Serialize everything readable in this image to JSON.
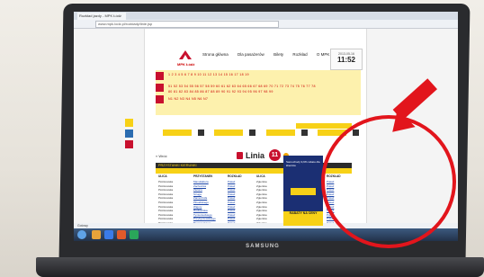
{
  "browser": {
    "tab_title": "Rozkład jazdy - MPK Łódź",
    "url": "www.mpk.lodz.pl/rozklady/linie.jsp"
  },
  "site": {
    "logo_text": "MPK Łódź",
    "nav": [
      "Strona główna",
      "Dla pasażerów",
      "Bilety",
      "Rozkład",
      "O MPK",
      "Kontakt"
    ],
    "clock": {
      "date": "2013-05-16",
      "time": "11:52"
    }
  },
  "lines": {
    "row1": "1 2 3 4 5 6 7 8 9 10 11 12 13 14 15 16 17 18 19",
    "row2": "51 52 53 54 55 56 57 58 59 60 61 62 63 64 65 66 67 68 69 70 71 72 73 74 75 76 77 78",
    "row3": "80 81 82 83 84 85 86 87 88 89 90 91 92 93 94 95 96 97 98 99",
    "row4": "N1 N2 N3 N4 N5 N6 N7"
  },
  "page": {
    "back_label": "« Wróć",
    "line_title": "Linia",
    "line_number": "11"
  },
  "table": {
    "header": "PRZYSTANKI KIERUNKI",
    "columns": [
      "ULICA",
      "PRZYSTANEK",
      "ROZKŁAD",
      "ULICA",
      "PRZYSTANEK",
      "ROZKŁAD"
    ],
    "rows": [
      [
        "Piotrkowska",
        "Manufaktura",
        "Pokaż",
        "Zgierska",
        "Stoki",
        "Pokaż"
      ],
      [
        "Piotrkowska",
        "Zachodnia",
        "Pokaż",
        "Zgierska",
        "Julianów",
        "Pokaż"
      ],
      [
        "Piotrkowska",
        "Zielona",
        "Pokaż",
        "Zgierska",
        "Radogoszcz",
        "Pokaż"
      ],
      [
        "Piotrkowska",
        "Struga",
        "Pokaż",
        "Zgierska",
        "Teofilów",
        "Pokaż"
      ],
      [
        "Piotrkowska",
        "Zamenhofa",
        "Pokaż",
        "Zgierska",
        "Bałuty",
        "Pokaż"
      ],
      [
        "Piotrkowska",
        "Piłsudskiego",
        "Pokaż",
        "Zgierska",
        "Doły",
        "Pokaż"
      ],
      [
        "Piotrkowska",
        "Wigury",
        "Pokaż",
        "Zgierska",
        "Marysin",
        "Pokaż"
      ],
      [
        "Piotrkowska",
        "Radwańska",
        "Pokaż",
        "Zgierska",
        "Helenówek",
        "Pokaż"
      ],
      [
        "Piotrkowska",
        "Tymienieckiego",
        "Pokaż",
        "Zgierska",
        "Rojna",
        "Pokaż"
      ],
      [
        "Piotrkowska",
        "Przybyszewskiego",
        "Pokaż",
        "Zgierska",
        "Kochanówka",
        "Pokaż"
      ],
      [
        "Piotrkowska",
        "Broniewskiego",
        "Pokaż",
        "Zgierska",
        "Łagiewniki",
        "Pokaż"
      ]
    ]
  },
  "ad": {
    "body": "Samochody 9,9% rabatu dla klientów",
    "footer": "RABATY NA CENY"
  },
  "status": {
    "text": "Gotowy"
  },
  "laptop": {
    "brand": "SAMSUNG"
  },
  "colors": {
    "annotation_red": "#e2151c",
    "mpk_yellow": "#f7d117",
    "mpk_red": "#c8102e"
  }
}
